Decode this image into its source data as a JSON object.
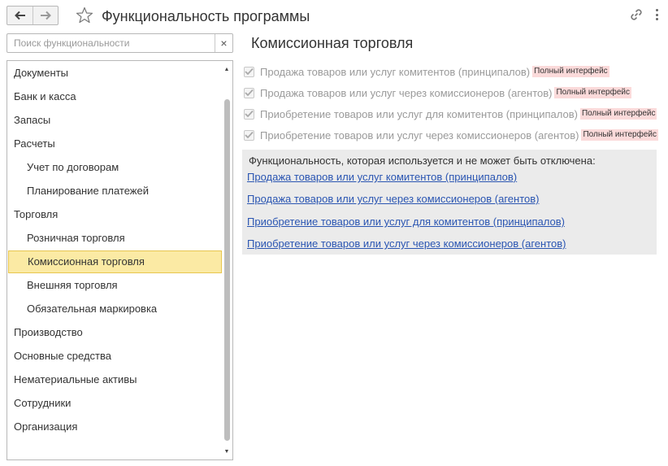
{
  "window": {
    "title": "Функциональность программы",
    "back_icon": "arrow-left-icon",
    "forward_icon": "arrow-right-icon",
    "favorite_icon": "star-outline-icon",
    "link_icon": "link-icon",
    "more_icon": "more-vertical-icon"
  },
  "search": {
    "placeholder": "Поиск функциональности",
    "value": "",
    "clear_label": "×"
  },
  "tree": {
    "items": [
      {
        "label": "Документы",
        "level": 0
      },
      {
        "label": "Банк и касса",
        "level": 0
      },
      {
        "label": "Запасы",
        "level": 0
      },
      {
        "label": "Расчеты",
        "level": 0
      },
      {
        "label": "Учет по договорам",
        "level": 1
      },
      {
        "label": "Планирование платежей",
        "level": 1
      },
      {
        "label": "Торговля",
        "level": 0
      },
      {
        "label": "Розничная торговля",
        "level": 1
      },
      {
        "label": "Комиссионная торговля",
        "level": 1,
        "selected": true
      },
      {
        "label": "Внешняя торговля",
        "level": 1
      },
      {
        "label": "Обязательная маркировка",
        "level": 1
      },
      {
        "label": "Производство",
        "level": 0
      },
      {
        "label": "Основные средства",
        "level": 0
      },
      {
        "label": "Нематериальные активы",
        "level": 0
      },
      {
        "label": "Сотрудники",
        "level": 0
      },
      {
        "label": "Организация",
        "level": 0
      }
    ],
    "scroll_up": "▲",
    "scroll_down": "▼"
  },
  "main": {
    "section_title": "Комиссионная торговля",
    "options": [
      {
        "label": "Продажа товаров или услуг комитентов (принципалов)",
        "badge": "Полный интерфейс",
        "checked": true,
        "disabled": true
      },
      {
        "label": "Продажа товаров или услуг через комиссионеров (агентов)",
        "badge": "Полный интерфейс",
        "checked": true,
        "disabled": true
      },
      {
        "label": "Приобретение товаров или услуг для комитентов (принципалов)",
        "badge": "Полный интерфейс",
        "checked": true,
        "disabled": true
      },
      {
        "label": "Приобретение товаров или услуг через комиссионеров (агентов)",
        "badge": "Полный интерфейс",
        "checked": true,
        "disabled": true
      }
    ],
    "info": {
      "heading": "Функциональность, которая используется и не может быть отключена:",
      "links": [
        "Продажа товаров или услуг комитентов (принципалов)",
        "Продажа товаров или услуг через комиссионеров (агентов)",
        "Приобретение товаров или услуг для комитентов (принципалов)",
        "Приобретение товаров или услуг через комиссионеров (агентов)"
      ]
    }
  },
  "colors": {
    "selection_bg": "#fbeaa4",
    "selection_border": "#e8c64f",
    "badge_bg": "#fbdada",
    "link": "#2a55b2",
    "info_bg": "#ebebeb"
  }
}
